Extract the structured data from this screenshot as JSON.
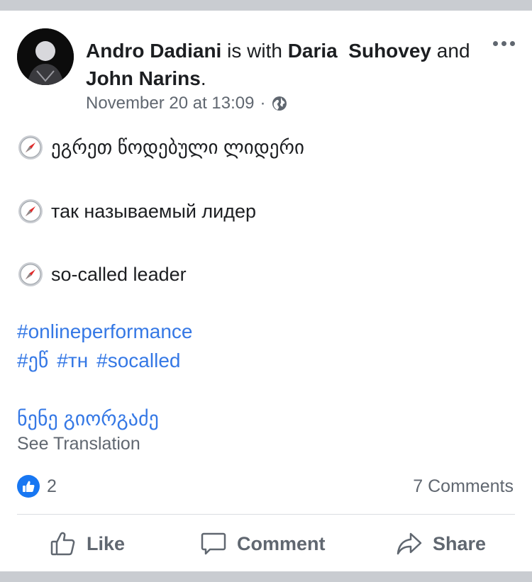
{
  "post": {
    "author": "Andro Dadiani",
    "with_text": " is with ",
    "tagged_1": "Daria  Suhovey",
    "and_text": " and ",
    "tagged_2": "John Narins",
    "period": ".",
    "date": "November 20 at 13:09",
    "separator": "·",
    "privacy_icon": "globe-icon",
    "lines": [
      "ეგრეთ წოდებული ლიდერი",
      "так называемый лидер",
      "so-called leader"
    ],
    "line_icon": "compass-icon",
    "hashtags_row1": [
      "#onlineperformance"
    ],
    "hashtags_row2": [
      "#ეწ",
      "#тн",
      "#socalled"
    ],
    "mention": "ნენე გიორგაძე",
    "see_translation": "See Translation"
  },
  "stats": {
    "reactions_count": "2",
    "comments": "7 Comments"
  },
  "actions": {
    "like": "Like",
    "comment": "Comment",
    "share": "Share"
  },
  "colors": {
    "link": "#3578e5",
    "like_badge": "#1877f2",
    "muted_text": "#606770",
    "band": "#c9ccd1"
  }
}
